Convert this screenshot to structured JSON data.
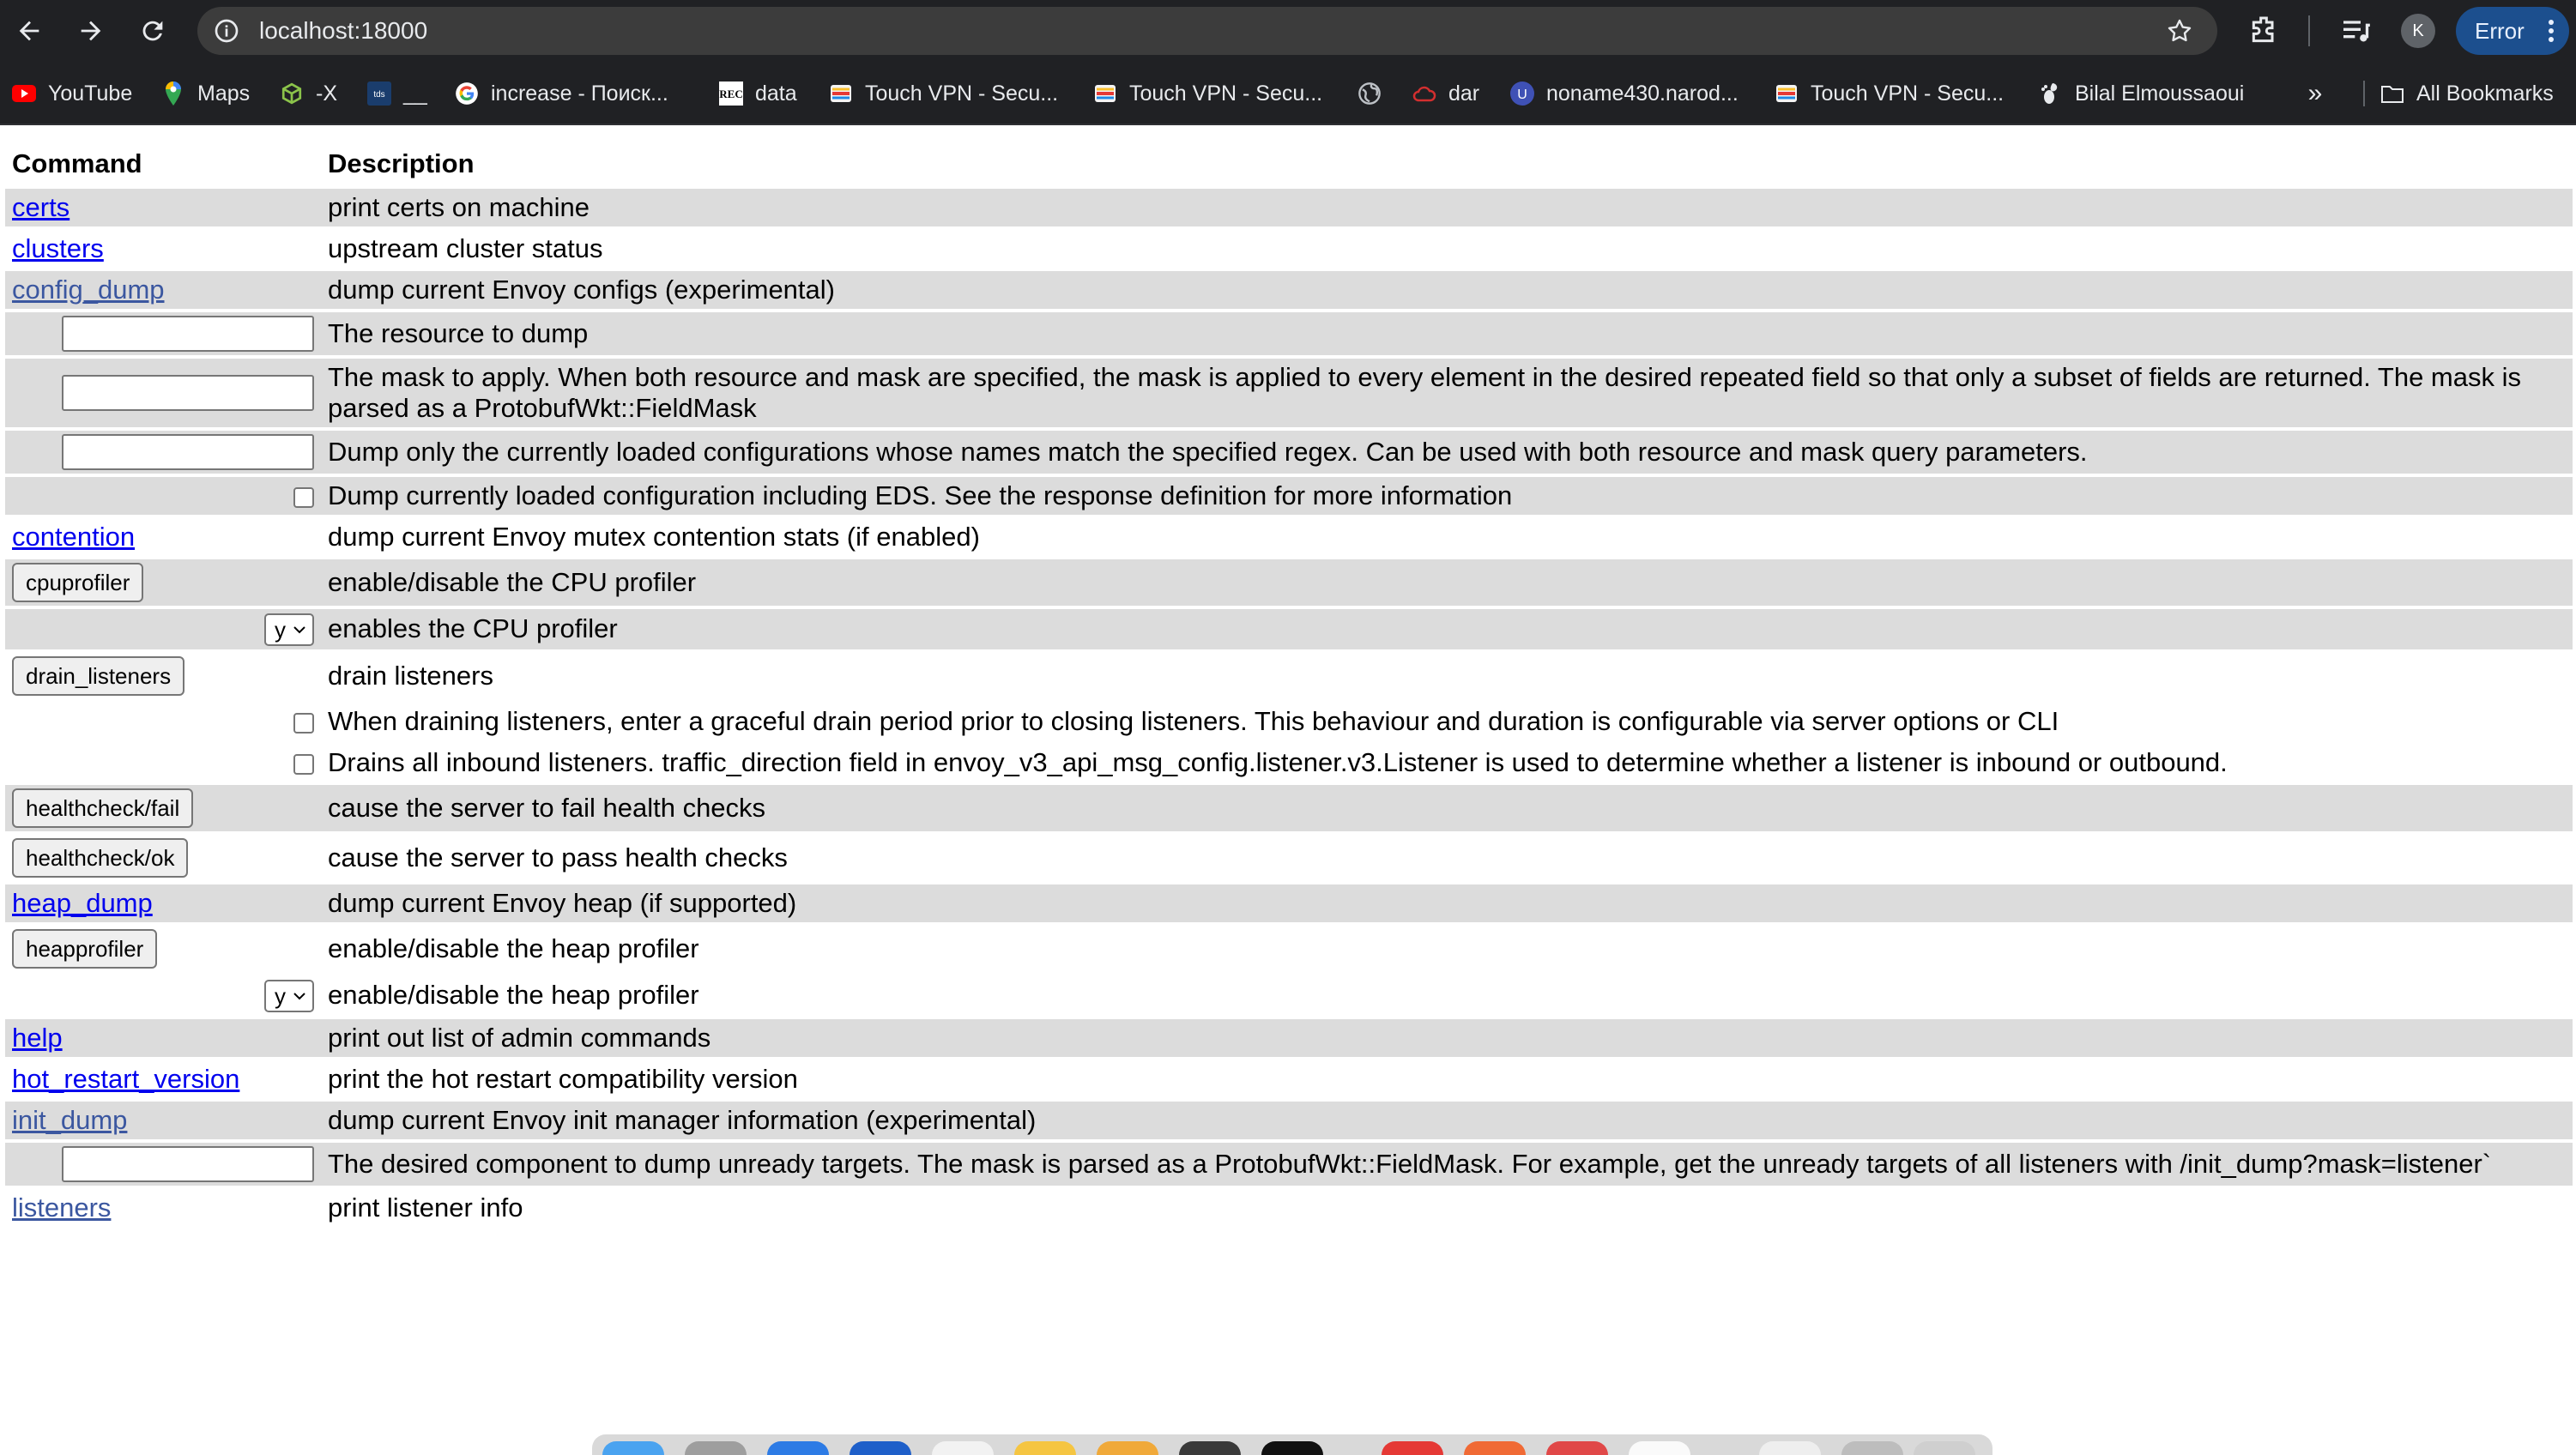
{
  "browser": {
    "url": "localhost:18000",
    "profile_initial": "K",
    "error_label": "Error",
    "bookmarks": [
      {
        "label": "YouTube",
        "icon": "youtube-icon"
      },
      {
        "label": "Maps",
        "icon": "maps-icon"
      },
      {
        "label": "-X",
        "icon": "cube-icon"
      },
      {
        "label": "__",
        "icon": "tds-icon"
      },
      {
        "label": "increase - Поиск...",
        "icon": "google-icon"
      },
      {
        "label": "data",
        "icon": "rec-icon"
      },
      {
        "label": "Touch VPN - Secu...",
        "icon": "touchvpn-icon"
      },
      {
        "label": "Touch VPN - Secu...",
        "icon": "touchvpn-icon"
      },
      {
        "label": "",
        "icon": "globe-icon"
      },
      {
        "label": "dar",
        "icon": "cloud-icon"
      },
      {
        "label": "noname430.narod...",
        "icon": "u-icon"
      },
      {
        "label": "Touch VPN - Secu...",
        "icon": "touchvpn-icon"
      },
      {
        "label": "Bilal Elmoussaoui",
        "icon": "gnome-icon"
      }
    ],
    "more_label": "»",
    "all_bookmarks": "All Bookmarks"
  },
  "table": {
    "headers": {
      "command": "Command",
      "description": "Description"
    },
    "rows": {
      "certs": {
        "cmd": "certs",
        "desc": "print certs on machine"
      },
      "clusters": {
        "cmd": "clusters",
        "desc": "upstream cluster status"
      },
      "config_dump": {
        "cmd": "config_dump",
        "desc": "dump current Envoy configs (experimental)",
        "param_resource": "The resource to dump",
        "param_mask": "The mask to apply. When both resource and mask are specified, the mask is applied to every element in the desired repeated field so that only a subset of fields are returned. The mask is parsed as a ProtobufWkt::FieldMask",
        "param_name_regex": "Dump only the currently loaded configurations whose names match the specified regex. Can be used with both resource and mask query parameters.",
        "param_include_eds": "Dump currently loaded configuration including EDS. See the response definition for more information"
      },
      "contention": {
        "cmd": "contention",
        "desc": "dump current Envoy mutex contention stats (if enabled)"
      },
      "cpuprofiler": {
        "cmd": "cpuprofiler",
        "desc": "enable/disable the CPU profiler",
        "select_value": "y",
        "param_enable": "enables the CPU profiler"
      },
      "drain_listeners": {
        "cmd": "drain_listeners",
        "desc": "drain listeners",
        "param_graceful": "When draining listeners, enter a graceful drain period prior to closing listeners. This behaviour and duration is configurable via server options or CLI",
        "param_inbound": "Drains all inbound listeners. traffic_direction field in envoy_v3_api_msg_config.listener.v3.Listener is used to determine whether a listener is inbound or outbound."
      },
      "healthcheck_fail": {
        "cmd": "healthcheck/fail",
        "desc": "cause the server to fail health checks"
      },
      "healthcheck_ok": {
        "cmd": "healthcheck/ok",
        "desc": "cause the server to pass health checks"
      },
      "heap_dump": {
        "cmd": "heap_dump",
        "desc": "dump current Envoy heap (if supported)"
      },
      "heapprofiler": {
        "cmd": "heapprofiler",
        "desc": "enable/disable the heap profiler",
        "select_value": "y",
        "param_enable": "enable/disable the heap profiler"
      },
      "help": {
        "cmd": "help",
        "desc": "print out list of admin commands"
      },
      "hot_restart_version": {
        "cmd": "hot_restart_version",
        "desc": "print the hot restart compatibility version"
      },
      "init_dump": {
        "cmd": "init_dump",
        "desc": "dump current Envoy init manager information (experimental)",
        "param_mask": "The desired component to dump unready targets. The mask is parsed as a ProtobufWkt::FieldMask. For example, get the unready targets of all listeners with /init_dump?mask=listener`"
      },
      "listeners": {
        "cmd": "listeners",
        "desc": "print listener info"
      }
    }
  }
}
